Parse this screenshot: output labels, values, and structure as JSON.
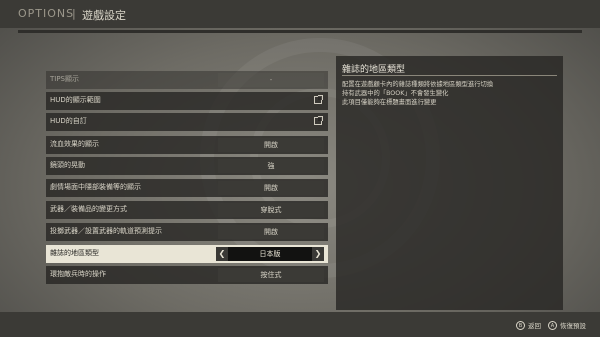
{
  "header": {
    "section": "OPTIONS",
    "separator": "|",
    "title": "遊戲設定"
  },
  "settings": [
    {
      "label": "TIPS顯示",
      "value": "-",
      "type": "faded"
    },
    {
      "label": "HUD的顯示範圍",
      "value": "",
      "type": "link"
    },
    {
      "label": "HUD的自訂",
      "value": "",
      "type": "link"
    },
    {
      "label": "流血效果的顯示",
      "value": "開啟",
      "type": "value"
    },
    {
      "label": "鏡頭的晃動",
      "value": "強",
      "type": "value"
    },
    {
      "label": "劇情場面中隱部裝備等的顯示",
      "value": "開啟",
      "type": "value"
    },
    {
      "label": "武器／裝備品的變更方式",
      "value": "穿脫式",
      "type": "value"
    },
    {
      "label": "投擲武器／設置武器的軌道預測提示",
      "value": "開啟",
      "type": "value"
    },
    {
      "label": "雜誌的地區類型",
      "value": "日本版",
      "type": "selected"
    },
    {
      "label": "環抱敵兵時的操作",
      "value": "按住式",
      "type": "value"
    }
  ],
  "description": {
    "title": "雜誌的地區類型",
    "text": "配置在遊戲顧卡內的雜誌種類將依據地區類型進行切換\n持有武器中的「BOOK」不會發生變化\n此項目僅能夠在標題畫面進行變更"
  },
  "footer": {
    "back_icon": "B",
    "back_label": "返回",
    "reset_icon": "A",
    "reset_label": "恢復預設"
  }
}
